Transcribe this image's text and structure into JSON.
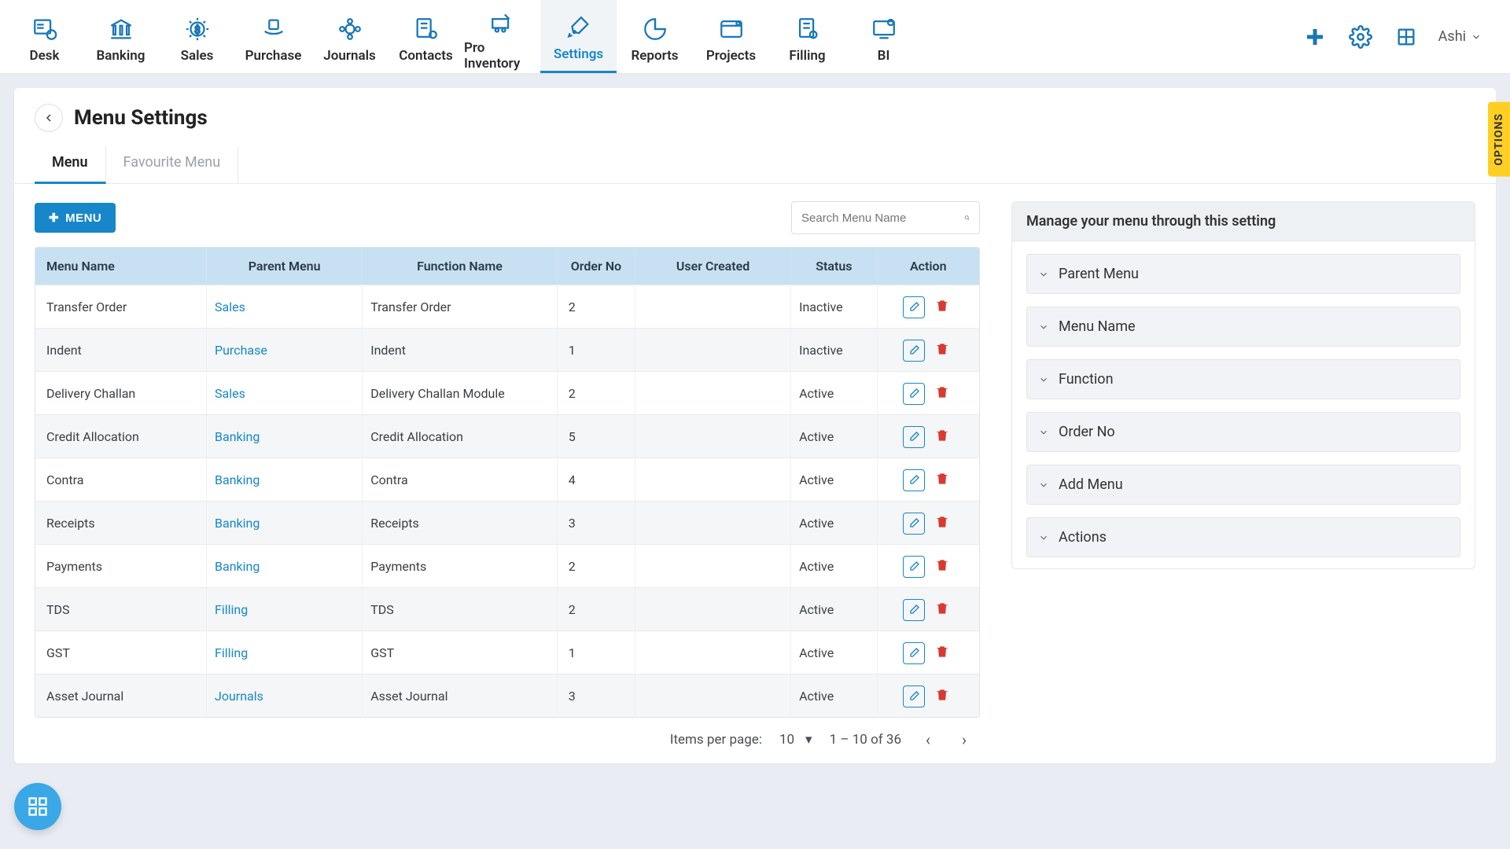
{
  "nav": {
    "items": [
      {
        "label": "Desk"
      },
      {
        "label": "Banking"
      },
      {
        "label": "Sales"
      },
      {
        "label": "Purchase"
      },
      {
        "label": "Journals"
      },
      {
        "label": "Contacts"
      },
      {
        "label": "Pro Inventory"
      },
      {
        "label": "Settings"
      },
      {
        "label": "Reports"
      },
      {
        "label": "Projects"
      },
      {
        "label": "Filling"
      },
      {
        "label": "BI"
      }
    ],
    "active_index": 7,
    "user": "Ashi"
  },
  "page": {
    "title": "Menu Settings",
    "tabs": [
      {
        "label": "Menu"
      },
      {
        "label": "Favourite Menu"
      }
    ],
    "active_tab": 0,
    "menu_button": "MENU",
    "search_placeholder": "Search Menu Name"
  },
  "table": {
    "columns": [
      "Menu Name",
      "Parent Menu",
      "Function Name",
      "Order No",
      "User Created",
      "Status",
      "Action"
    ],
    "rows": [
      {
        "menu": "Transfer Order",
        "parent": "Sales",
        "func": "Transfer Order",
        "order": "2",
        "user": "",
        "status": "Inactive"
      },
      {
        "menu": "Indent",
        "parent": "Purchase",
        "func": "Indent",
        "order": "1",
        "user": "",
        "status": "Inactive"
      },
      {
        "menu": "Delivery Challan",
        "parent": "Sales",
        "func": "Delivery Challan Module",
        "order": "2",
        "user": "",
        "status": "Active"
      },
      {
        "menu": "Credit Allocation",
        "parent": "Banking",
        "func": "Credit Allocation",
        "order": "5",
        "user": "",
        "status": "Active"
      },
      {
        "menu": "Contra",
        "parent": "Banking",
        "func": "Contra",
        "order": "4",
        "user": "",
        "status": "Active"
      },
      {
        "menu": "Receipts",
        "parent": "Banking",
        "func": "Receipts",
        "order": "3",
        "user": "",
        "status": "Active"
      },
      {
        "menu": "Payments",
        "parent": "Banking",
        "func": "Payments",
        "order": "2",
        "user": "",
        "status": "Active"
      },
      {
        "menu": "TDS",
        "parent": "Filling",
        "func": "TDS",
        "order": "2",
        "user": "",
        "status": "Active"
      },
      {
        "menu": "GST",
        "parent": "Filling",
        "func": "GST",
        "order": "1",
        "user": "",
        "status": "Active"
      },
      {
        "menu": "Asset Journal",
        "parent": "Journals",
        "func": "Asset Journal",
        "order": "3",
        "user": "",
        "status": "Active"
      }
    ]
  },
  "pager": {
    "label": "Items per page:",
    "size": "10",
    "range": "1 – 10 of 36"
  },
  "side": {
    "title": "Manage your menu through this setting",
    "items": [
      {
        "label": "Parent Menu"
      },
      {
        "label": "Menu Name"
      },
      {
        "label": "Function"
      },
      {
        "label": "Order No"
      },
      {
        "label": "Add Menu"
      },
      {
        "label": "Actions"
      }
    ]
  },
  "options_flag": "OPTIONS"
}
